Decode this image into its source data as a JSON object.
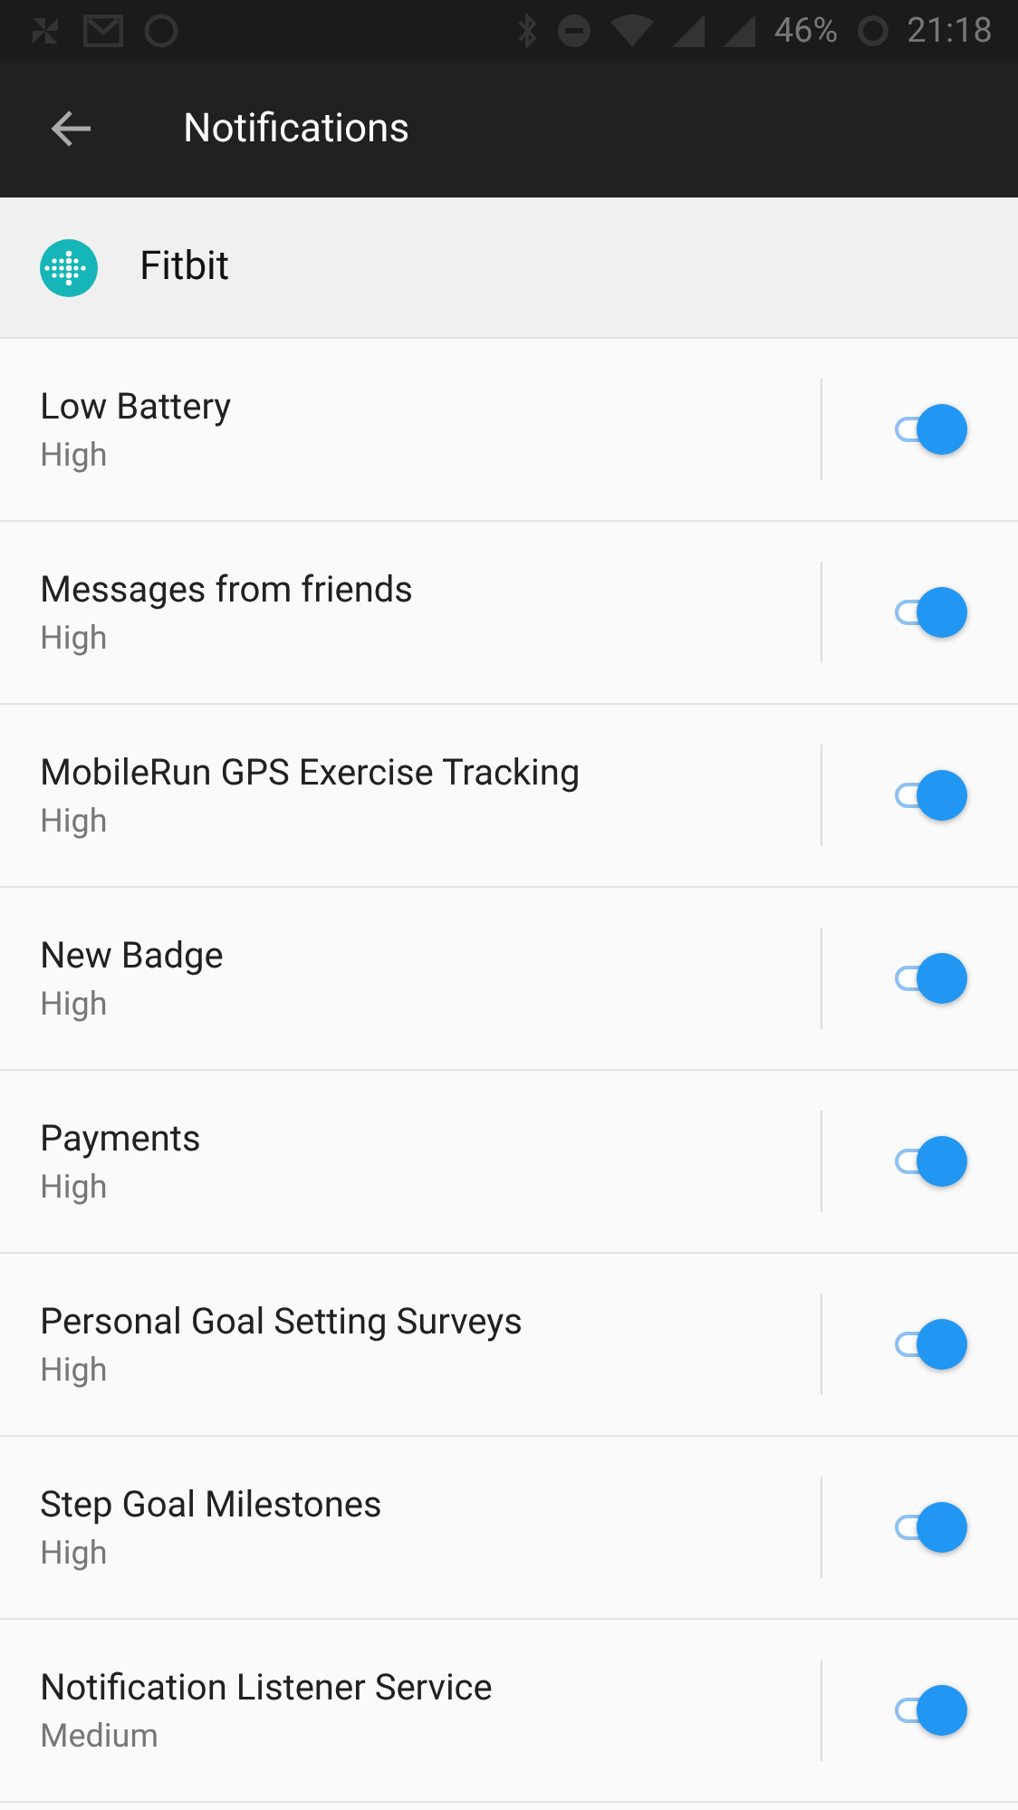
{
  "status_bar": {
    "battery": "46%",
    "time": "21:18"
  },
  "app_bar": {
    "title": "Notifications"
  },
  "app_header": {
    "name": "Fitbit"
  },
  "channels": [
    {
      "name": "Low Battery",
      "importance": "High",
      "on": true
    },
    {
      "name": "Messages from friends",
      "importance": "High",
      "on": true
    },
    {
      "name": "MobileRun GPS Exercise Tracking",
      "importance": "High",
      "on": true
    },
    {
      "name": "New Badge",
      "importance": "High",
      "on": true
    },
    {
      "name": "Payments",
      "importance": "High",
      "on": true
    },
    {
      "name": "Personal Goal Setting Surveys",
      "importance": "High",
      "on": true
    },
    {
      "name": "Step Goal Milestones",
      "importance": "High",
      "on": true
    },
    {
      "name": "Notification Listener Service",
      "importance": "Medium",
      "on": true
    }
  ]
}
